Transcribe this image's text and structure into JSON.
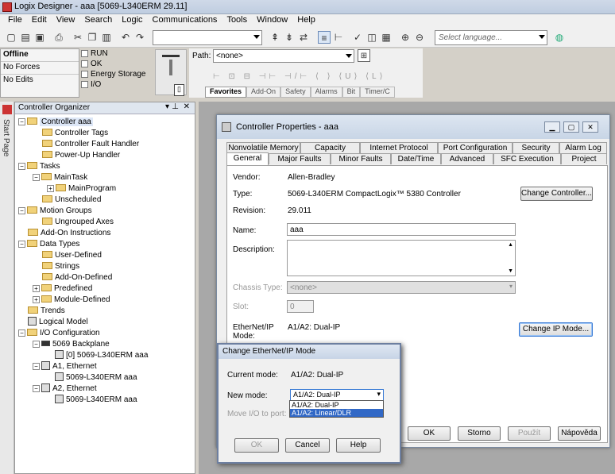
{
  "window": {
    "title": "Logix Designer - aaa [5069-L340ERM 29.11]"
  },
  "menu": [
    "File",
    "Edit",
    "View",
    "Search",
    "Logic",
    "Communications",
    "Tools",
    "Window",
    "Help"
  ],
  "toolbar": {
    "language_placeholder": "Select language..."
  },
  "status": {
    "mode": "Offline",
    "forces": "No Forces",
    "edits": "No Edits",
    "indicators": [
      "RUN",
      "OK",
      "Energy Storage",
      "I/O"
    ]
  },
  "path": {
    "label": "Path:",
    "value": "<none>"
  },
  "instr_tabs": [
    "Favorites",
    "Add-On",
    "Safety",
    "Alarms",
    "Bit",
    "Timer/C"
  ],
  "sidebar": {
    "start_page": "Start Page"
  },
  "organizer": {
    "title": "Controller Organizer",
    "nodes": {
      "controller": "Controller aaa",
      "tags": "Controller Tags",
      "fault": "Controller Fault Handler",
      "powerup": "Power-Up Handler",
      "tasks": "Tasks",
      "maintask": "MainTask",
      "mainprogram": "MainProgram",
      "unscheduled": "Unscheduled",
      "motion": "Motion Groups",
      "ungrouped": "Ungrouped Axes",
      "aoi": "Add-On Instructions",
      "datatypes": "Data Types",
      "userdef": "User-Defined",
      "strings": "Strings",
      "aodef": "Add-On-Defined",
      "predef": "Predefined",
      "moddef": "Module-Defined",
      "trends": "Trends",
      "logical": "Logical Model",
      "io": "I/O Configuration",
      "backplane": "5069 Backplane",
      "slot0": "[0] 5069-L340ERM aaa",
      "a1": "A1, Ethernet",
      "a1dev": "5069-L340ERM aaa",
      "a2": "A2, Ethernet",
      "a2dev": "5069-L340ERM aaa"
    }
  },
  "props": {
    "title": "Controller Properties - aaa",
    "tabs_row1": [
      "Nonvolatile Memory",
      "Capacity",
      "Internet Protocol",
      "Port Configuration",
      "Security",
      "Alarm Log"
    ],
    "tabs_row2": [
      "General",
      "Major Faults",
      "Minor Faults",
      "Date/Time",
      "Advanced",
      "SFC Execution",
      "Project"
    ],
    "vendor_label": "Vendor:",
    "vendor": "Allen-Bradley",
    "type_label": "Type:",
    "type": "5069-L340ERM CompactLogix™ 5380 Controller",
    "revision_label": "Revision:",
    "revision": "29.011",
    "name_label": "Name:",
    "name": "aaa",
    "desc_label": "Description:",
    "chassis_label": "Chassis Type:",
    "chassis": "<none>",
    "slot_label": "Slot:",
    "slot": "0",
    "enip_label": "EtherNet/IP Mode:",
    "enip": "A1/A2: Dual-IP",
    "change_controller": "Change Controller...",
    "change_ip": "Change IP Mode...",
    "ok": "OK",
    "cancel": "Storno",
    "apply": "Použít",
    "help": "Nápověda"
  },
  "modedlg": {
    "title": "Change EtherNet/IP Mode",
    "current_label": "Current mode:",
    "current": "A1/A2: Dual-IP",
    "new_label": "New mode:",
    "new_value": "A1/A2: Dual-IP",
    "options": [
      "A1/A2: Dual-IP",
      "A1/A2: Linear/DLR"
    ],
    "move_label": "Move I/O to port:",
    "ok": "OK",
    "cancel": "Cancel",
    "help": "Help"
  }
}
